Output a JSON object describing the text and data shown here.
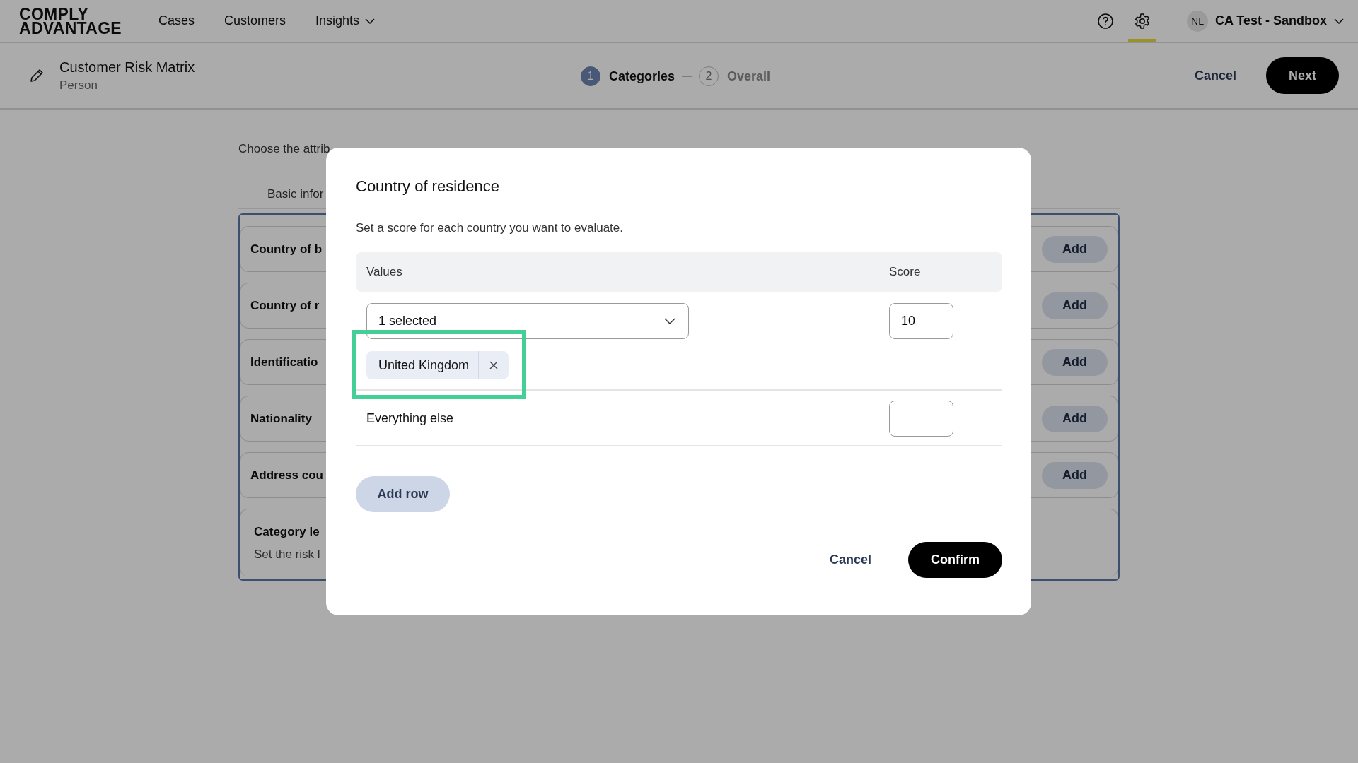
{
  "header": {
    "logo": [
      "COMPLY",
      "ADVANTAGE"
    ],
    "nav": [
      {
        "label": "Cases",
        "dropdown": false
      },
      {
        "label": "Customers",
        "dropdown": false
      },
      {
        "label": "Insights",
        "dropdown": true
      }
    ],
    "toolbar_icons": [
      {
        "kind": "help",
        "selected": false
      },
      {
        "kind": "settings",
        "selected": true
      }
    ],
    "account": {
      "initials": "NL",
      "name": "CA Test - Sandbox"
    }
  },
  "subheader": {
    "title": "Customer Risk Matrix",
    "subtitle": "Person",
    "steps": [
      {
        "number": "1",
        "label": "Categories",
        "selected": true
      },
      {
        "number": "2",
        "label": "Overall",
        "selected": false
      }
    ],
    "cancel": "Cancel",
    "next": "Next"
  },
  "content": {
    "intro": "Choose the attrib",
    "tab": "Basic infor",
    "rows": [
      {
        "label": "Country of b",
        "action": "Add"
      },
      {
        "label": "Country of r",
        "action": "Add"
      },
      {
        "label": "Identificatio",
        "action": "Add"
      },
      {
        "label": "Nationality",
        "action": "Add"
      },
      {
        "label": "Address cou",
        "action": "Add"
      }
    ],
    "category_level": {
      "title": "Category le",
      "description": "Set the risk l"
    }
  },
  "modal": {
    "title": "Country of residence",
    "description": "Set a score for each country you want to evaluate.",
    "columns": [
      "Values",
      "Score"
    ],
    "rows": [
      {
        "kind": "select",
        "value": "1 selected",
        "chips": [
          {
            "label": "United Kingdom",
            "highlighted": true
          }
        ],
        "score": "10"
      },
      {
        "kind": "fixed",
        "label": "Everything else"
      }
    ],
    "add_row": "Add row",
    "cancel": "Cancel",
    "confirm": "Confirm"
  }
}
